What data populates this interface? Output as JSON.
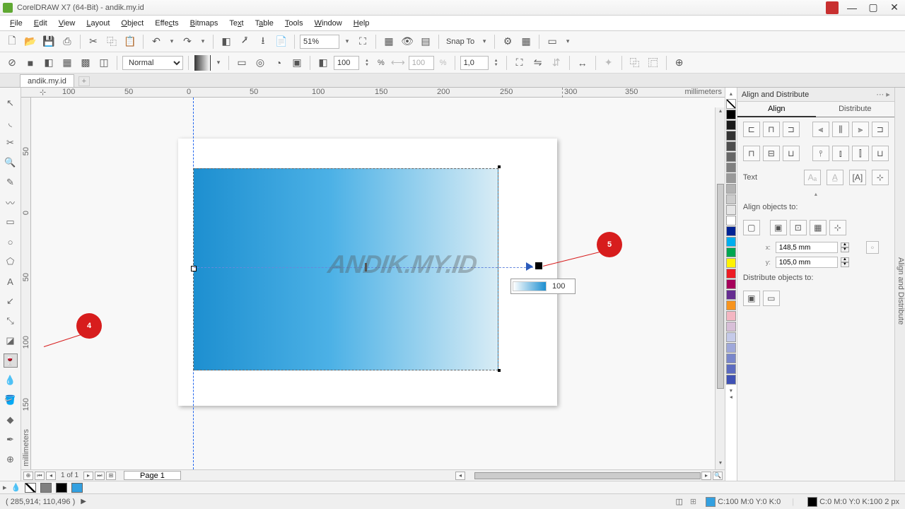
{
  "app": {
    "title": "CorelDRAW X7 (64-Bit) - andik.my.id"
  },
  "menu": [
    "File",
    "Edit",
    "View",
    "Layout",
    "Object",
    "Effects",
    "Bitmaps",
    "Text",
    "Table",
    "Tools",
    "Window",
    "Help"
  ],
  "toolbar1": {
    "zoom": "51%",
    "snapto": "Snap To"
  },
  "toolbar2": {
    "blend": "Normal",
    "opacity": "100",
    "opacity2": "100",
    "opacity3": "1,0",
    "pct": "%"
  },
  "doctab": {
    "name": "andik.my.id"
  },
  "ruler": {
    "h": [
      "100",
      "50",
      "0",
      "50",
      "100",
      "150",
      "200",
      "250",
      "300",
      "350"
    ],
    "hunit": "millimeters",
    "v": [
      "50",
      "0",
      "50",
      "100",
      "150"
    ],
    "vunit": "millimeters"
  },
  "canvas": {
    "watermark": "ANDIK.MY.ID",
    "opvalue": "100"
  },
  "annot": {
    "four": "4",
    "five": "5"
  },
  "hscroll": {
    "pageof": "1 of 1",
    "pagetab": "Page 1"
  },
  "docker": {
    "title": "Align and Distribute",
    "tabs": [
      "Align",
      "Distribute"
    ],
    "textlabel": "Text",
    "alignto": "Align objects to:",
    "x": "148,5 mm",
    "y": "105,0 mm",
    "xl": "x:",
    "yl": "y:",
    "distto": "Distribute objects to:",
    "sidetab": "Align and Distribute"
  },
  "palette": [
    "#000000",
    "#404040",
    "#808080",
    "#c0c0c0",
    "#ffffff",
    "#e8e8e8",
    "#f0f0f0",
    "#f8f8f8",
    "#ffffff",
    "#ffffff",
    "#002395",
    "#0093d3",
    "#00a651",
    "#fff200",
    "#ed1c24",
    "#a6005a",
    "#662d91",
    "#f7941e",
    "#f4b6c2",
    "#c2b0e0",
    "#b0c4de",
    "#91a3b0",
    "#6e7b8b"
  ],
  "colorbar": {
    "swatches": [
      "#ffffff",
      "#808080",
      "#000000",
      "#3399dd"
    ]
  },
  "status": {
    "coords": "( 285,914; 110,496 )",
    "fill": "C:100 M:0 Y:0 K:0",
    "outline": "C:0 M:0 Y:0 K:100  2 px"
  }
}
